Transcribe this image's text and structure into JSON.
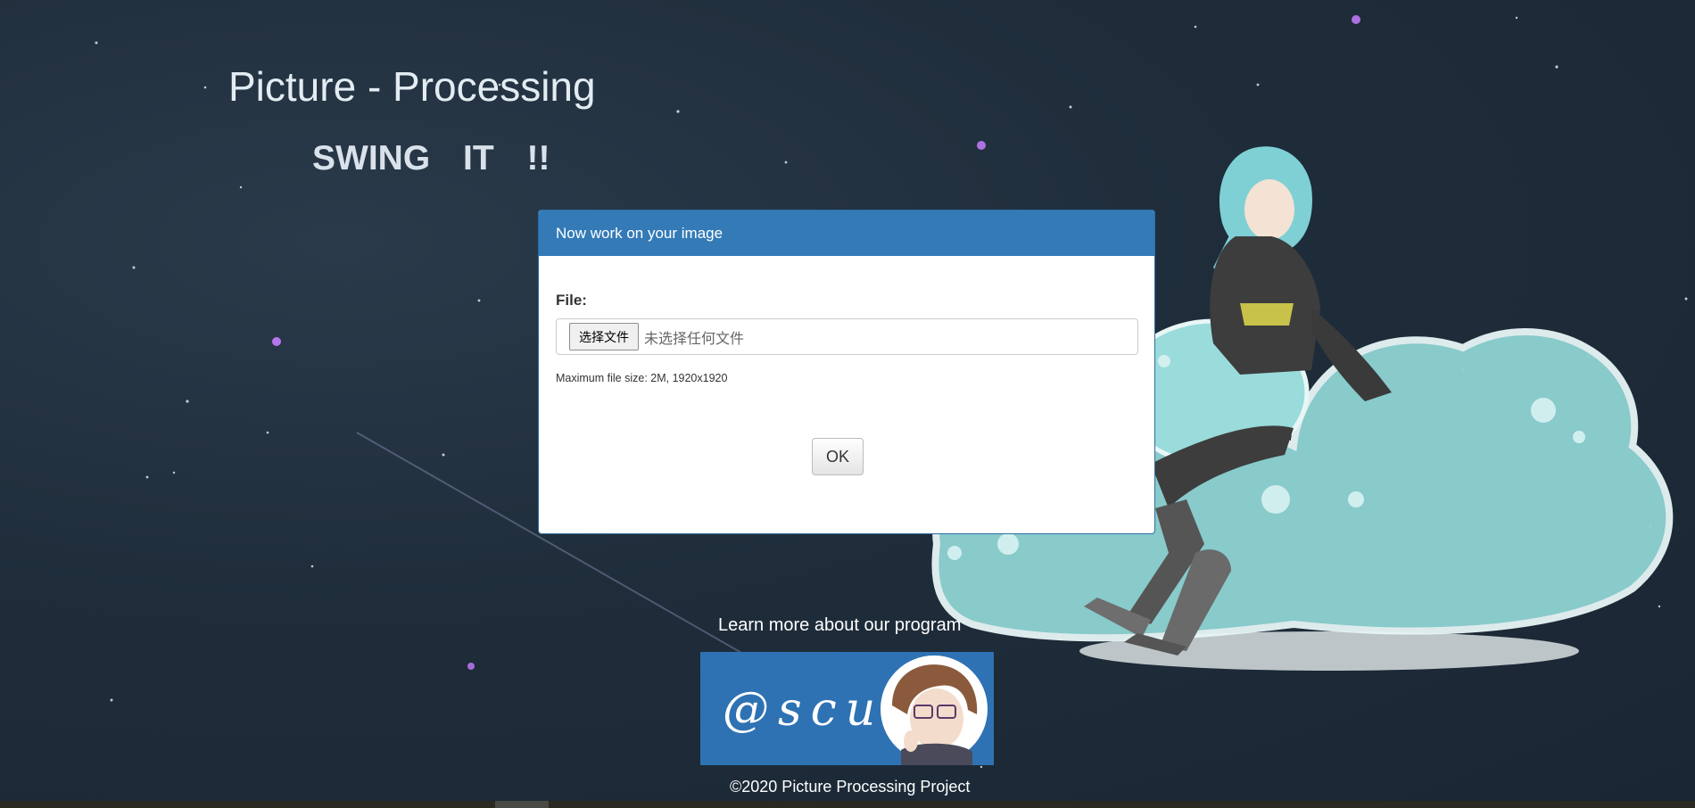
{
  "header": {
    "title": "Picture - Processing",
    "tagline": "SWING IT !!"
  },
  "upload_panel": {
    "heading": "Now work on your image",
    "file_label": "File:",
    "choose_button": "选择文件",
    "file_status": "未选择任何文件",
    "help_text": "Maximum file size: 2M, 1920x1920",
    "submit_label": "OK"
  },
  "footer": {
    "learn_more": "Learn more about our program",
    "banner_text": "@scu",
    "copyright": "©2020 Picture Processing Project"
  },
  "colors": {
    "background": "#1f2d3b",
    "panel_heading": "#337ab7",
    "banner": "#2e72b4",
    "slime": "#8fd3d3"
  }
}
